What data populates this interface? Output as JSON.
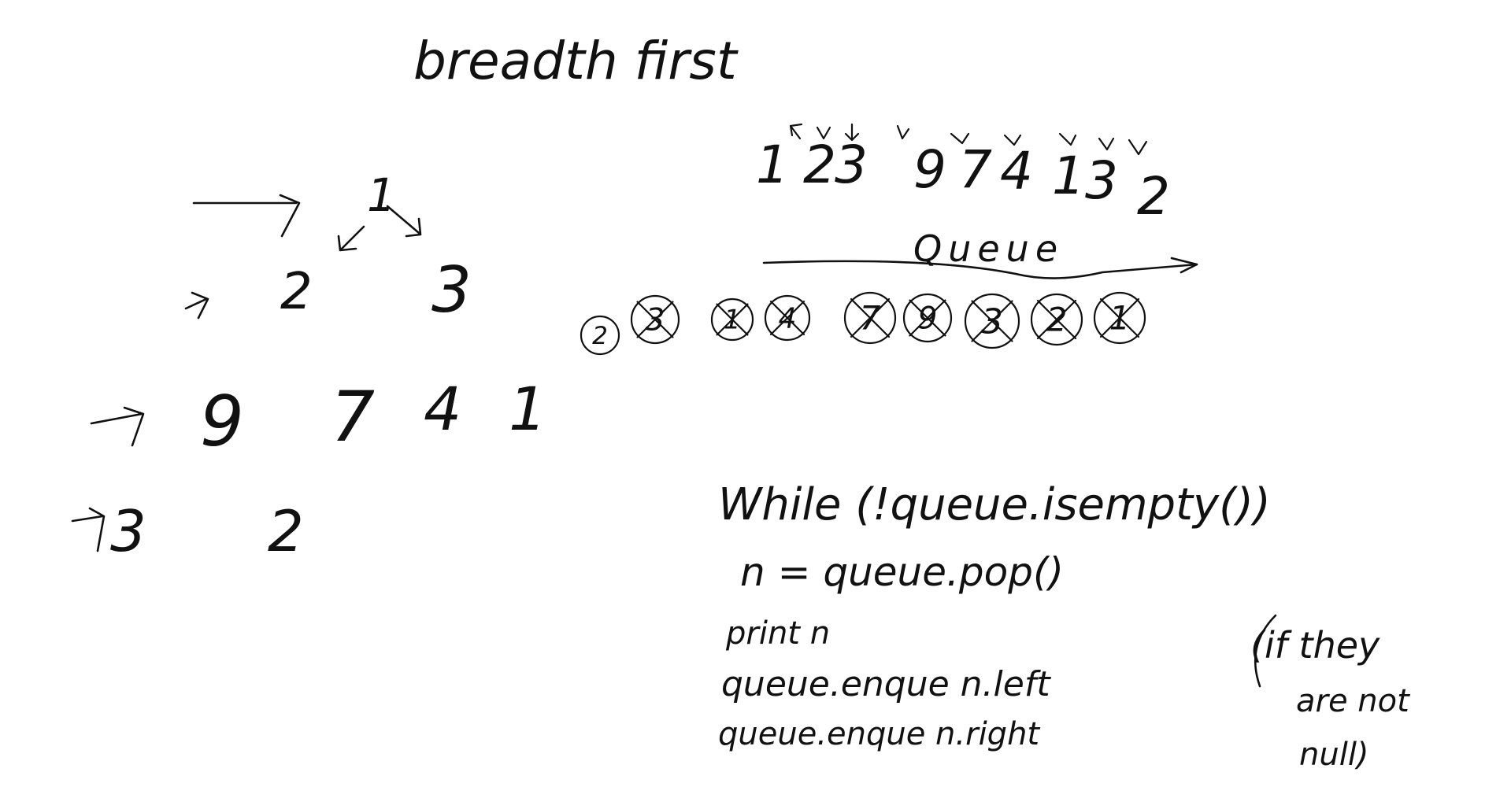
{
  "title": "breadth first",
  "tree": {
    "levels": [
      [
        "1"
      ],
      [
        "2",
        "3"
      ],
      [
        "9",
        "7",
        "4",
        "1"
      ],
      [
        "3",
        "2"
      ]
    ]
  },
  "traversal_order": [
    "1",
    "2",
    "3",
    "9",
    "7",
    "4",
    "1",
    "3",
    "2"
  ],
  "queue": {
    "label": "Queue",
    "items": [
      "2",
      "3",
      "1",
      "4",
      "7",
      "9",
      "3",
      "2",
      "1"
    ],
    "crossed": [
      false,
      true,
      true,
      true,
      true,
      true,
      true,
      true,
      true
    ]
  },
  "pseudocode": {
    "lines": [
      "While (!queue.isempty())",
      "n = queue.pop()",
      "print n",
      "queue.enque n.left",
      "queue.enque n.right"
    ],
    "note": [
      "(if they",
      "are not",
      "null)"
    ]
  },
  "ink_color": "#111111",
  "background_color": "#ffffff"
}
